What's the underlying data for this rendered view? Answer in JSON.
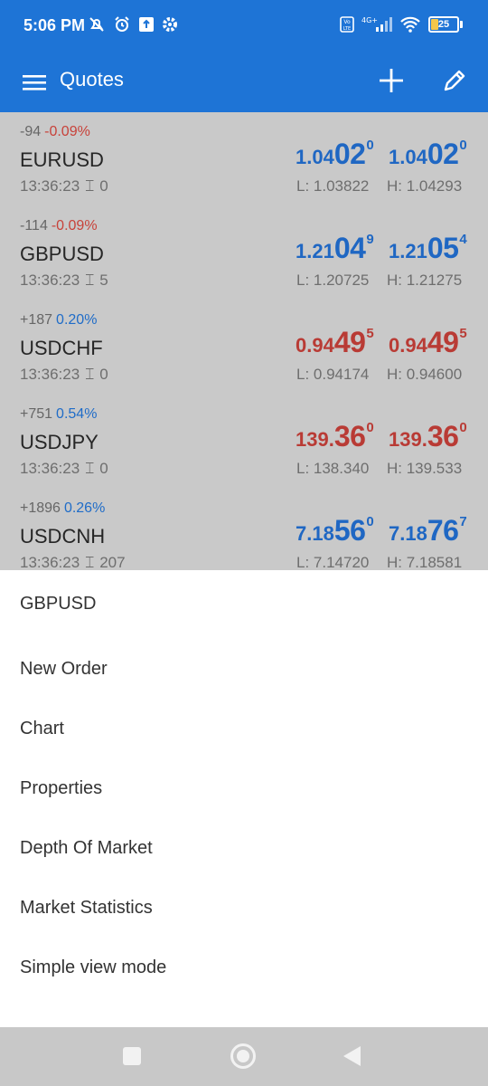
{
  "status_bar": {
    "time": "5:06 PM",
    "battery": "25",
    "network": "4G+",
    "icons_left": [
      "mute-icon",
      "alarm-icon",
      "upload-icon",
      "settings-icon"
    ],
    "icons_right": [
      "volte-icon",
      "signal-icon",
      "wifi-icon",
      "battery-icon"
    ]
  },
  "app_bar": {
    "title": "Quotes",
    "icons": [
      "menu-icon",
      "plus-icon",
      "pencil-icon"
    ]
  },
  "colors": {
    "primary": "#1e74d6",
    "price_up": "#1f67c3",
    "price_down": "#b93b35",
    "change_negative": "#c8423a",
    "change_positive": "#1f6cc8"
  },
  "quotes": [
    {
      "change_points": "-94",
      "change_pct": "-0.09%",
      "direction": "negative",
      "symbol": "EURUSD",
      "time": "13:36:23",
      "spread": "0",
      "bid": {
        "small": "1.04",
        "big": "02",
        "sup": "0",
        "color": "blue"
      },
      "ask": {
        "small": "1.04",
        "big": "02",
        "sup": "0",
        "color": "blue"
      },
      "low": "L: 1.03822",
      "high": "H: 1.04293"
    },
    {
      "change_points": "-114",
      "change_pct": "-0.09%",
      "direction": "negative",
      "symbol": "GBPUSD",
      "time": "13:36:23",
      "spread": "5",
      "bid": {
        "small": "1.21",
        "big": "04",
        "sup": "9",
        "color": "blue"
      },
      "ask": {
        "small": "1.21",
        "big": "05",
        "sup": "4",
        "color": "blue"
      },
      "low": "L: 1.20725",
      "high": "H: 1.21275"
    },
    {
      "change_points": "+187",
      "change_pct": "0.20%",
      "direction": "positive",
      "symbol": "USDCHF",
      "time": "13:36:23",
      "spread": "0",
      "bid": {
        "small": "0.94",
        "big": "49",
        "sup": "5",
        "color": "red"
      },
      "ask": {
        "small": "0.94",
        "big": "49",
        "sup": "5",
        "color": "red"
      },
      "low": "L: 0.94174",
      "high": "H: 0.94600"
    },
    {
      "change_points": "+751",
      "change_pct": "0.54%",
      "direction": "positive",
      "symbol": "USDJPY",
      "time": "13:36:23",
      "spread": "0",
      "bid": {
        "small": "139.",
        "big": "36",
        "sup": "0",
        "color": "red"
      },
      "ask": {
        "small": "139.",
        "big": "36",
        "sup": "0",
        "color": "red"
      },
      "low": "L: 138.340",
      "high": "H: 139.533"
    },
    {
      "change_points": "+1896",
      "change_pct": "0.26%",
      "direction": "positive",
      "symbol": "USDCNH",
      "time": "13:36:23",
      "spread": "207",
      "bid": {
        "small": "7.18",
        "big": "56",
        "sup": "0",
        "color": "blue"
      },
      "ask": {
        "small": "7.18",
        "big": "76",
        "sup": "7",
        "color": "blue"
      },
      "low": "L: 7.14720",
      "high": "H: 7.18581"
    }
  ],
  "context_menu": {
    "title": "GBPUSD",
    "items": [
      {
        "label": "New Order"
      },
      {
        "label": "Chart"
      },
      {
        "label": "Properties"
      },
      {
        "label": "Depth Of Market"
      },
      {
        "label": "Market Statistics"
      },
      {
        "label": "Simple view mode"
      }
    ]
  },
  "nav_bar": {
    "icons": [
      "recent-apps-icon",
      "home-icon",
      "back-icon"
    ]
  }
}
